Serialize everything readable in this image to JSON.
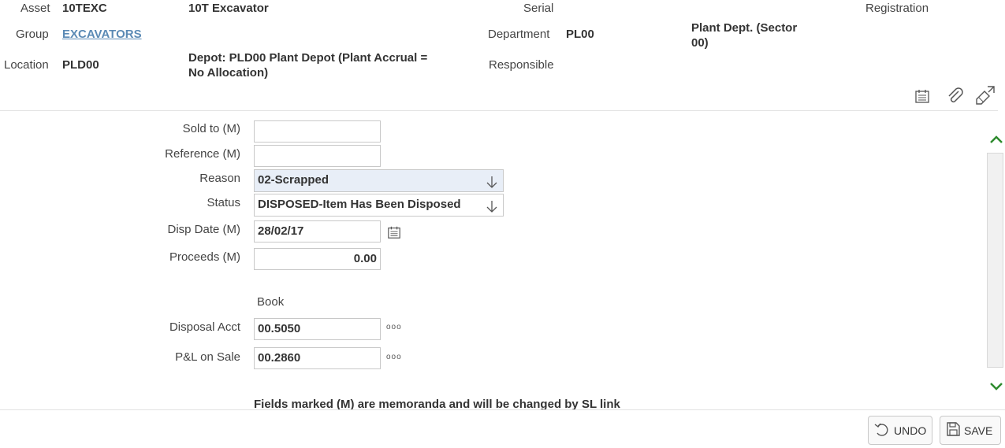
{
  "header": {
    "asset_label": "Asset",
    "asset_value": "10TEXC",
    "asset_desc": "10T Excavator",
    "serial_label": "Serial",
    "registration_label": "Registration",
    "group_label": "Group",
    "group_value": "EXCAVATORS",
    "department_label": "Department",
    "department_value": "PL00",
    "department_desc": "Plant Dept. (Sector 00)",
    "location_label": "Location",
    "location_value": "PLD00",
    "location_desc": "Depot: PLD00 Plant Depot (Plant Accrual = No Allocation)",
    "responsible_label": "Responsible"
  },
  "toolbar_icons": [
    "calendar-icon",
    "paperclip-icon",
    "edit-expand-icon"
  ],
  "form": {
    "sold_to_label": "Sold to (M)",
    "sold_to_value": "",
    "reference_label": "Reference (M)",
    "reference_value": "",
    "reason_label": "Reason",
    "reason_value": "02-Scrapped",
    "status_label": "Status",
    "status_value": "DISPOSED-Item Has Been Disposed",
    "disp_date_label": "Disp Date (M)",
    "disp_date_value": "28/02/17",
    "proceeds_label": "Proceeds (M)",
    "proceeds_value": "0.00",
    "book_label": "Book",
    "disposal_acct_label": "Disposal Acct",
    "disposal_acct_value": "00.5050",
    "pl_on_sale_label": "P&L on Sale",
    "pl_on_sale_value": "00.2860",
    "lookup_glyph": "ooo",
    "note": "Fields marked (M) are memoranda and will be changed by SL link"
  },
  "footer": {
    "undo_label": "UNDO",
    "save_label": "SAVE"
  },
  "colors": {
    "link": "#5b8ab5",
    "select_bg": "#e8eef7",
    "chevron": "#2e8b2e"
  }
}
